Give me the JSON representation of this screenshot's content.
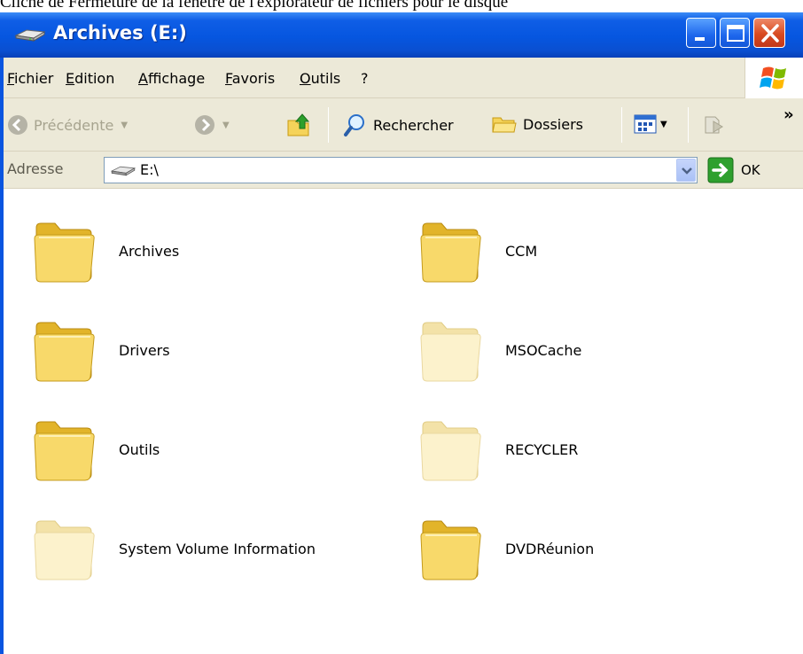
{
  "caption_fragment": "Cliché de Fermeture de la fenêtre de l'explorateur de fichiers pour le disque",
  "window": {
    "title": "Archives (E:)",
    "controls": {
      "minimize": "minimize",
      "maximize": "maximize",
      "close": "close"
    }
  },
  "menu": {
    "items": [
      "Fichier",
      "Edition",
      "Affichage",
      "Favoris",
      "Outils",
      "?"
    ]
  },
  "toolbar": {
    "back_label": "Précédente",
    "search_label": "Rechercher",
    "folders_label": "Dossiers",
    "more": "»"
  },
  "address": {
    "label": "Adresse",
    "value": "E:\\",
    "go_label": "OK"
  },
  "folders": [
    {
      "name": "Archives",
      "hidden": false
    },
    {
      "name": "CCM",
      "hidden": false
    },
    {
      "name": "Drivers",
      "hidden": false
    },
    {
      "name": "MSOCache",
      "hidden": true
    },
    {
      "name": "Outils",
      "hidden": false
    },
    {
      "name": "RECYCLER",
      "hidden": true
    },
    {
      "name": "System Volume Information",
      "hidden": true
    },
    {
      "name": "DVDRéunion",
      "hidden": false
    }
  ],
  "colors": {
    "titlebar": "#0656e0",
    "chrome": "#ece9d8",
    "folder": "#f7d663",
    "hidden_folder": "#fbf0c4"
  },
  "icons": {
    "drive": "drive-icon",
    "back": "back-arrow-icon",
    "forward": "forward-arrow-icon",
    "up": "folder-up-icon",
    "search": "search-icon",
    "folders": "folders-icon",
    "views": "views-icon",
    "go": "go-arrow-icon",
    "folder": "folder-icon"
  }
}
